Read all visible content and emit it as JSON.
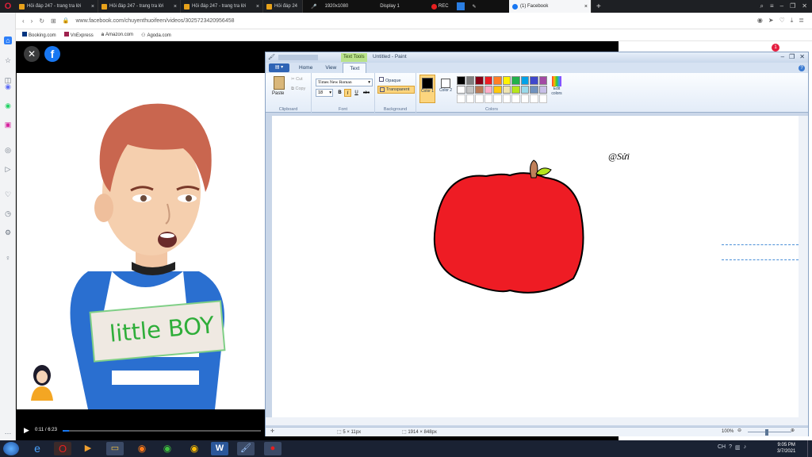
{
  "browser": {
    "tabs": [
      {
        "label": "Hỏi đáp 247 - trang tra lời",
        "close": "×"
      },
      {
        "label": "Hỏi đáp 247 - trang tra lời",
        "close": "×"
      },
      {
        "label": "Hỏi đáp 247 - trang tra lời",
        "close": "×"
      },
      {
        "label": "Hỏi đáp 24",
        "close": ""
      },
      {
        "label": "(1) Facebook",
        "close": "×"
      }
    ],
    "new_tab": "+",
    "overlay": {
      "resolution": "1920x1080",
      "display": "Display 1",
      "rec": "REC"
    },
    "url": "www.facebook.com/chuyenthuoifeen/videos/3025723420956458",
    "bookmarks": [
      "Booking.com",
      "VnExpress",
      "Amazon.com",
      "Agoda.com"
    ]
  },
  "video": {
    "sticker_text": "little BOY",
    "time": "0:11 / 6:23",
    "progress": 0.03
  },
  "paint": {
    "title": "Untitled - Paint",
    "context_tab": "Text Tools",
    "tabs": [
      "Home",
      "View",
      "Text"
    ],
    "clipboard": {
      "paste": "Paste",
      "cut": "Cut",
      "copy": "Copy",
      "label": "Clipboard"
    },
    "font": {
      "family": "Times New Roman",
      "size": "18",
      "label": "Font",
      "bold": "B",
      "italic": "I",
      "underline": "U",
      "strike": "abc"
    },
    "background": {
      "opaque": "Opaque",
      "transparent": "Transparent",
      "label": "Background"
    },
    "colors": {
      "color1": "Color 1",
      "color2": "Color 2",
      "label": "Colors",
      "edit": "Edit colors"
    },
    "canvas_text": "@Sửi",
    "status": {
      "cursor": "5 × 11px",
      "size": "1914 × 848px",
      "zoom": "100%"
    },
    "palette": [
      "#000000",
      "#7f7f7f",
      "#880015",
      "#ed1c24",
      "#ff7f27",
      "#fff200",
      "#22b14c",
      "#00a2e8",
      "#3f48cc",
      "#a349a4",
      "#ffffff",
      "#c3c3c3",
      "#b97a57",
      "#ffaec9",
      "#ffc90e",
      "#efe4b0",
      "#b5e61d",
      "#99d9ea",
      "#7092be",
      "#c8bfe7"
    ]
  },
  "taskbar": {
    "time": "9:05 PM",
    "date": "3/7/2021"
  },
  "notification_count": "1"
}
